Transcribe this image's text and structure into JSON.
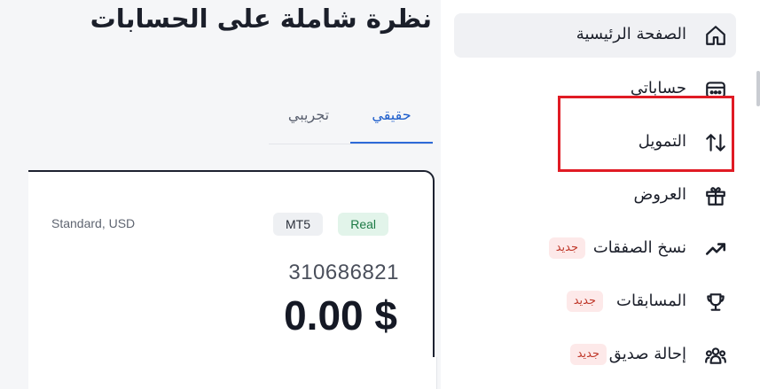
{
  "header": {
    "title": "نظرة شاملة على الحسابات"
  },
  "tabs": [
    {
      "label": "حقيقي",
      "active": true
    },
    {
      "label": "تجريبي",
      "active": false
    }
  ],
  "account_card": {
    "type": "Standard, USD",
    "platform_badge": "MT5",
    "status_badge": "Real",
    "account_number": "310686821",
    "balance": "0.00 $"
  },
  "sidebar": {
    "items": [
      {
        "label": "الصفحة الرئيسية",
        "icon": "home-icon",
        "active": true
      },
      {
        "label": "حساباتي",
        "icon": "wallet-icon"
      },
      {
        "label": "التمويل",
        "icon": "transfer-arrows-icon"
      },
      {
        "label": "العروض",
        "icon": "gift-icon"
      },
      {
        "label": "نسخ الصفقات",
        "icon": "trending-up-icon",
        "badge": "جديد"
      },
      {
        "label": "المسابقات",
        "icon": "trophy-icon",
        "badge": "جديد"
      },
      {
        "label": "إحالة صديق",
        "icon": "users-icon",
        "badge": "جديد"
      }
    ]
  },
  "colors": {
    "accent": "#2d6ad8",
    "real_badge_bg": "#e2f4ea",
    "new_badge_bg": "#fde9e9",
    "highlight": "#e01b24"
  }
}
